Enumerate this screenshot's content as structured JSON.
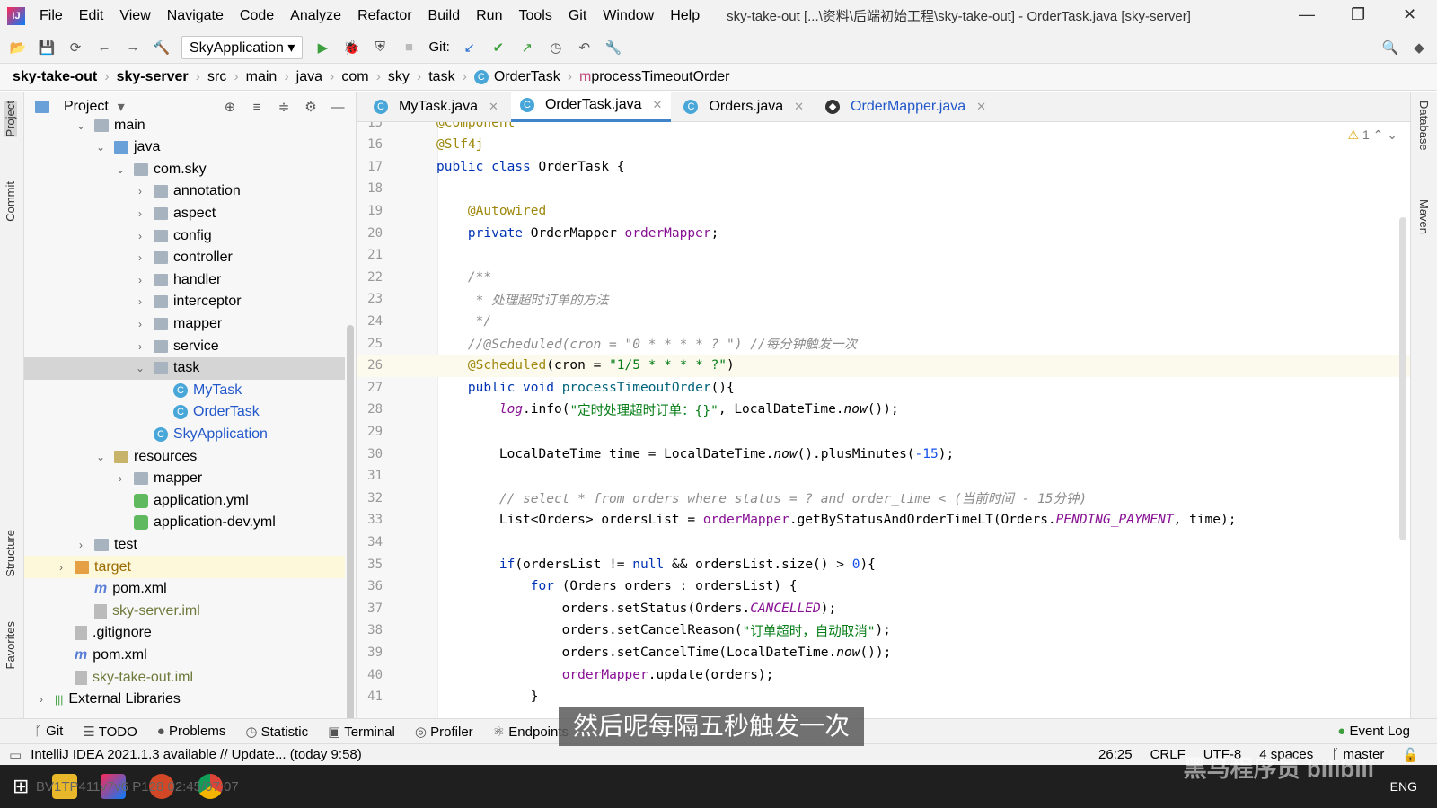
{
  "window": {
    "title": "sky-take-out [...\\资料\\后端初始工程\\sky-take-out] - OrderTask.java [sky-server]"
  },
  "menu": [
    "File",
    "Edit",
    "View",
    "Navigate",
    "Code",
    "Analyze",
    "Refactor",
    "Build",
    "Run",
    "Tools",
    "Git",
    "Window",
    "Help"
  ],
  "toolbar": {
    "run_config": "SkyApplication",
    "git_label": "Git:"
  },
  "breadcrumb": [
    "sky-take-out",
    "sky-server",
    "src",
    "main",
    "java",
    "com",
    "sky",
    "task",
    "OrderTask",
    "processTimeoutOrder"
  ],
  "project": {
    "title": "Project",
    "tree": [
      {
        "label": "main",
        "depth": 3,
        "type": "folder",
        "open": true
      },
      {
        "label": "java",
        "depth": 4,
        "type": "src",
        "open": true
      },
      {
        "label": "com.sky",
        "depth": 5,
        "type": "folder",
        "open": true
      },
      {
        "label": "annotation",
        "depth": 6,
        "type": "folder",
        "open": false
      },
      {
        "label": "aspect",
        "depth": 6,
        "type": "folder",
        "open": false
      },
      {
        "label": "config",
        "depth": 6,
        "type": "folder",
        "open": false
      },
      {
        "label": "controller",
        "depth": 6,
        "type": "folder",
        "open": false
      },
      {
        "label": "handler",
        "depth": 6,
        "type": "folder",
        "open": false
      },
      {
        "label": "interceptor",
        "depth": 6,
        "type": "folder",
        "open": false
      },
      {
        "label": "mapper",
        "depth": 6,
        "type": "folder",
        "open": false
      },
      {
        "label": "service",
        "depth": 6,
        "type": "folder",
        "open": false
      },
      {
        "label": "task",
        "depth": 6,
        "type": "folder",
        "open": true,
        "selected": true
      },
      {
        "label": "MyTask",
        "depth": 7,
        "type": "class"
      },
      {
        "label": "OrderTask",
        "depth": 7,
        "type": "class"
      },
      {
        "label": "SkyApplication",
        "depth": 6,
        "type": "class",
        "leaf": true
      },
      {
        "label": "resources",
        "depth": 4,
        "type": "res",
        "open": true
      },
      {
        "label": "mapper",
        "depth": 5,
        "type": "folder",
        "open": false
      },
      {
        "label": "application.yml",
        "depth": 5,
        "type": "yml",
        "leaf": true
      },
      {
        "label": "application-dev.yml",
        "depth": 5,
        "type": "yml",
        "leaf": true
      },
      {
        "label": "test",
        "depth": 3,
        "type": "folder",
        "open": false
      },
      {
        "label": "target",
        "depth": 2,
        "type": "orange",
        "open": false,
        "highlight": true
      },
      {
        "label": "pom.xml",
        "depth": 3,
        "type": "xml",
        "leaf": true
      },
      {
        "label": "sky-server.iml",
        "depth": 3,
        "type": "doc",
        "leaf": true,
        "olive": true
      },
      {
        "label": ".gitignore",
        "depth": 2,
        "type": "doc",
        "leaf": true
      },
      {
        "label": "pom.xml",
        "depth": 2,
        "type": "xml",
        "leaf": true
      },
      {
        "label": "sky-take-out.iml",
        "depth": 2,
        "type": "doc",
        "leaf": true,
        "olive": true
      },
      {
        "label": "External Libraries",
        "depth": 1,
        "type": "lib",
        "open": false
      }
    ]
  },
  "tabs": [
    {
      "label": "MyTask.java"
    },
    {
      "label": "OrderTask.java",
      "active": true
    },
    {
      "label": "Orders.java"
    },
    {
      "label": "OrderMapper.java",
      "blue": true
    }
  ],
  "editor": {
    "warning_count": "1",
    "current_line": 26,
    "lines": [
      {
        "n": "15",
        "t": [
          [
            "a",
            "@Component"
          ]
        ]
      },
      {
        "n": "16",
        "t": [
          [
            "a",
            "@Slf4j"
          ]
        ]
      },
      {
        "n": "17",
        "t": [
          [
            "k",
            "public class "
          ],
          [
            "",
            "OrderTask {"
          ]
        ]
      },
      {
        "n": "18",
        "t": []
      },
      {
        "n": "19",
        "t": [
          [
            "",
            "    "
          ],
          [
            "a",
            "@Autowired"
          ]
        ]
      },
      {
        "n": "20",
        "t": [
          [
            "",
            "    "
          ],
          [
            "k",
            "private "
          ],
          [
            "",
            "OrderMapper "
          ],
          [
            "f",
            "orderMapper"
          ],
          [
            "",
            ";"
          ]
        ]
      },
      {
        "n": "21",
        "t": []
      },
      {
        "n": "22",
        "t": [
          [
            "c",
            "    /**"
          ]
        ]
      },
      {
        "n": "23",
        "t": [
          [
            "c",
            "     * 处理超时订单的方法"
          ]
        ]
      },
      {
        "n": "24",
        "t": [
          [
            "c",
            "     */"
          ]
        ]
      },
      {
        "n": "25",
        "t": [
          [
            "c",
            "    //@Scheduled(cron = \"0 * * * * ? \") //每分钟触发一次"
          ]
        ]
      },
      {
        "n": "26",
        "t": [
          [
            "",
            "    "
          ],
          [
            "a",
            "@Scheduled"
          ],
          [
            "",
            "(cron = "
          ],
          [
            "s",
            "\"1/5 * * * * ?\""
          ],
          [
            "",
            ")"
          ]
        ]
      },
      {
        "n": "27",
        "t": [
          [
            "",
            "    "
          ],
          [
            "k",
            "public void "
          ],
          [
            "m",
            "processTimeoutOrder"
          ],
          [
            "",
            "(){"
          ]
        ]
      },
      {
        "n": "28",
        "t": [
          [
            "",
            "        "
          ],
          [
            "sf",
            "log"
          ],
          [
            "",
            ".info("
          ],
          [
            "s",
            "\"定时处理超时订单：{}\""
          ],
          [
            "",
            ", LocalDateTime."
          ],
          [
            "i",
            "now"
          ],
          [
            "",
            "());"
          ]
        ]
      },
      {
        "n": "29",
        "t": []
      },
      {
        "n": "30",
        "t": [
          [
            "",
            "        LocalDateTime time = LocalDateTime."
          ],
          [
            "i",
            "now"
          ],
          [
            "",
            "().plusMinutes("
          ],
          [
            "n",
            "-15"
          ],
          [
            "",
            ");"
          ]
        ]
      },
      {
        "n": "31",
        "t": []
      },
      {
        "n": "32",
        "t": [
          [
            "c",
            "        // select * from orders where status = ? and order_time < (当前时间 - 15分钟)"
          ]
        ]
      },
      {
        "n": "33",
        "t": [
          [
            "",
            "        List<Orders> ordersList = "
          ],
          [
            "f",
            "orderMapper"
          ],
          [
            "",
            ".getByStatusAndOrderTimeLT(Orders."
          ],
          [
            "sf",
            "PENDING_PAYMENT"
          ],
          [
            "",
            ", time);"
          ]
        ]
      },
      {
        "n": "34",
        "t": []
      },
      {
        "n": "35",
        "t": [
          [
            "",
            "        "
          ],
          [
            "k",
            "if"
          ],
          [
            "",
            "(ordersList != "
          ],
          [
            "k",
            "null"
          ],
          [
            "",
            " && ordersList.size() > "
          ],
          [
            "n",
            "0"
          ],
          [
            "",
            "){"
          ]
        ]
      },
      {
        "n": "36",
        "t": [
          [
            "",
            "            "
          ],
          [
            "k",
            "for "
          ],
          [
            "",
            "(Orders orders : ordersList) {"
          ]
        ]
      },
      {
        "n": "37",
        "t": [
          [
            "",
            "                orders.setStatus(Orders."
          ],
          [
            "sf",
            "CANCELLED"
          ],
          [
            "",
            ");"
          ]
        ]
      },
      {
        "n": "38",
        "t": [
          [
            "",
            "                orders.setCancelReason("
          ],
          [
            "s",
            "\"订单超时，自动取消\""
          ],
          [
            "",
            ");"
          ]
        ]
      },
      {
        "n": "39",
        "t": [
          [
            "",
            "                orders.setCancelTime(LocalDateTime."
          ],
          [
            "i",
            "now"
          ],
          [
            "",
            "());"
          ]
        ]
      },
      {
        "n": "40",
        "t": [
          [
            "",
            "                "
          ],
          [
            "f",
            "orderMapper"
          ],
          [
            "",
            ".update(orders);"
          ]
        ]
      },
      {
        "n": "41",
        "t": [
          [
            "",
            "            }"
          ]
        ]
      }
    ]
  },
  "left_strip": [
    "Project",
    "Commit",
    "Structure",
    "Favorites"
  ],
  "right_strip": [
    "Database",
    "Maven"
  ],
  "tool_windows": [
    "Git",
    "TODO",
    "Problems",
    "Statistic",
    "Terminal",
    "Profiler",
    "Endpoints"
  ],
  "event_log": "Event Log",
  "status": {
    "message": "IntelliJ IDEA 2021.1.3 available // Update... (today 9:58)",
    "position": "26:25",
    "line_sep": "CRLF",
    "encoding": "UTF-8",
    "indent": "4 spaces",
    "branch": "master"
  },
  "subtitle": "然后呢每隔五秒触发一次",
  "watermark": "黑马程序员 bilibili",
  "taskbar_overlay": "BV1TP411v7v6 P128 02:45/07:07",
  "taskbar_lang": "ENG"
}
